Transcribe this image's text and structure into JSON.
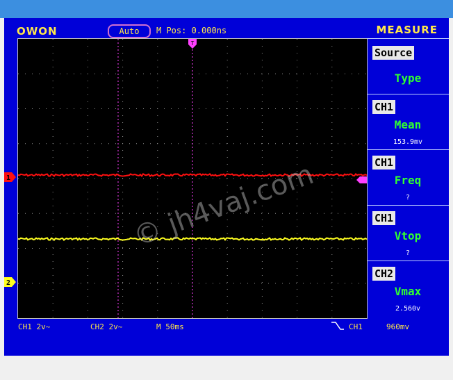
{
  "brand": "OWON",
  "trigger_mode": "Auto",
  "m_pos": "M Pos: 0.000ns",
  "menu_title": "MEASURE",
  "menu": [
    {
      "label": "Source",
      "value": "Type",
      "reading": ""
    },
    {
      "label": "CH1",
      "value": "Mean",
      "reading": "153.9mv"
    },
    {
      "label": "CH1",
      "value": "Freq",
      "reading": "?"
    },
    {
      "label": "CH1",
      "value": "Vtop",
      "reading": "?"
    },
    {
      "label": "CH2",
      "value": "Vmax",
      "reading": "2.560v"
    }
  ],
  "status": {
    "ch1": "CH1  2v~",
    "ch2": "CH2  2v~",
    "timebase": "M 50ms",
    "trigger_source": "CH1",
    "trigger_level": "960mv"
  },
  "markers": {
    "ch1": "1",
    "ch2": "2",
    "trigger": "T"
  },
  "watermark": "© jh4vaj.com",
  "colors": {
    "ch1": "#ff1010",
    "ch2": "#ffff20",
    "frame": "#0000d8",
    "cursor": "#ff40ff",
    "text": "#ffe84a",
    "menu_value": "#30ff30"
  }
}
